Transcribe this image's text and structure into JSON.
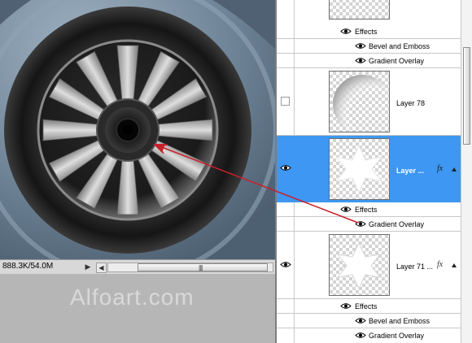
{
  "status": {
    "doc_size": "888.3K/54.0M",
    "arrow_glyph": "▶",
    "scroll_left_glyph": "◀",
    "scroll_grip": "||||"
  },
  "watermark": "Alfoart.com",
  "layers_panel": {
    "top_group": {
      "effects_label": "Effects",
      "effects": [
        "Bevel and Emboss",
        "Gradient Overlay"
      ]
    },
    "layers": [
      {
        "name": "Layer 78",
        "visible": false,
        "selected": false,
        "has_fx": false
      },
      {
        "name": "Layer ...",
        "visible": true,
        "selected": true,
        "has_fx": true,
        "fx": "fx",
        "effects_label": "Effects",
        "effects": [
          "Gradient Overlay"
        ]
      },
      {
        "name": "Layer 71 ...",
        "visible": true,
        "selected": false,
        "has_fx": true,
        "fx": "fx",
        "effects_label": "Effects",
        "effects": [
          "Bevel and Emboss",
          "Gradient Overlay"
        ]
      }
    ]
  },
  "colors": {
    "selection": "#3e97f2",
    "annotation_arrow": "#c8202a",
    "car_body": "#6a7e90"
  },
  "icons": [
    "eye-icon",
    "fx-icon",
    "expand-triangle-icon",
    "visibility-checkbox"
  ]
}
